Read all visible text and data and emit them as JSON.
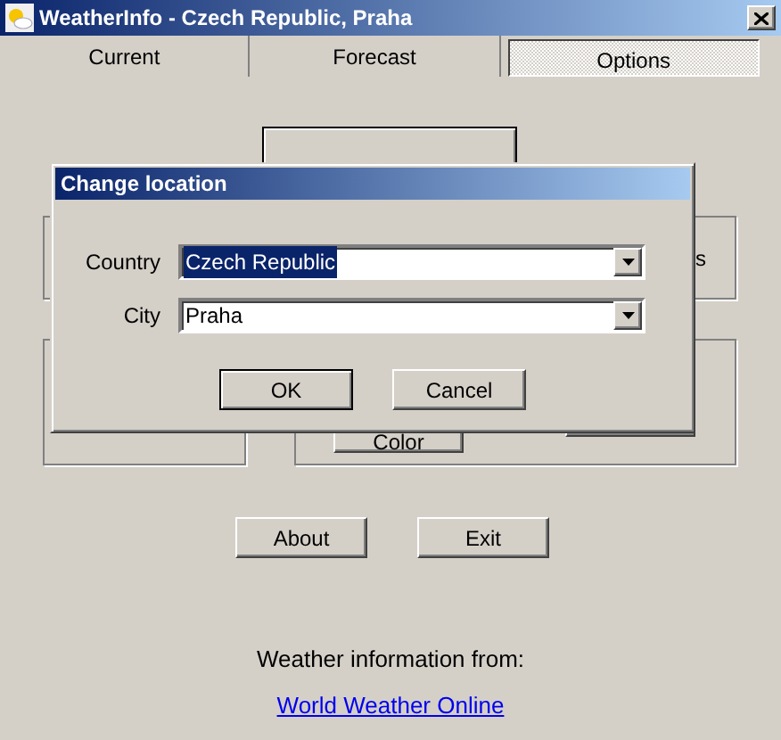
{
  "window": {
    "title": "WeatherInfo - Czech Republic, Praha"
  },
  "tabs": [
    {
      "label": "Current",
      "selected": false
    },
    {
      "label": "Forecast",
      "selected": false
    },
    {
      "label": "Options",
      "selected": true
    }
  ],
  "options_panel": {
    "partial_label": "s",
    "color_button": "Color",
    "buttons": [
      "About",
      "Exit"
    ],
    "source_caption": "Weather information from:",
    "source_link": "World Weather Online"
  },
  "dialog": {
    "title": "Change location",
    "fields": [
      {
        "label": "Country",
        "value": "Czech Republic",
        "text_selected": true
      },
      {
        "label": "City",
        "value": "Praha",
        "text_selected": false
      }
    ],
    "buttons": [
      {
        "label": "OK",
        "default": true
      },
      {
        "label": "Cancel",
        "default": false
      }
    ]
  }
}
